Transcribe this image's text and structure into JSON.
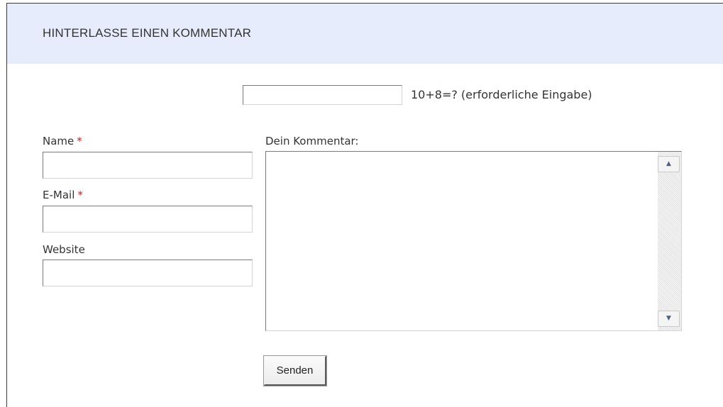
{
  "header": {
    "title": "HINTERLASSE EINEN KOMMENTAR"
  },
  "captcha": {
    "value": "",
    "question": "10+8=? (erforderliche Eingabe)"
  },
  "form": {
    "name_label": "Name",
    "email_label": "E-Mail",
    "website_label": "Website",
    "required_marker": "*",
    "comment_label": "Dein Kommentar:",
    "name_value": "",
    "email_value": "",
    "website_value": "",
    "comment_value": ""
  },
  "submit": {
    "label": "Senden"
  },
  "scrollbar": {
    "up_icon": "arrow-up-icon",
    "down_icon": "arrow-down-icon"
  },
  "colors": {
    "header_bg": "#e6ecfb",
    "required": "#e01010",
    "text": "#333333"
  }
}
